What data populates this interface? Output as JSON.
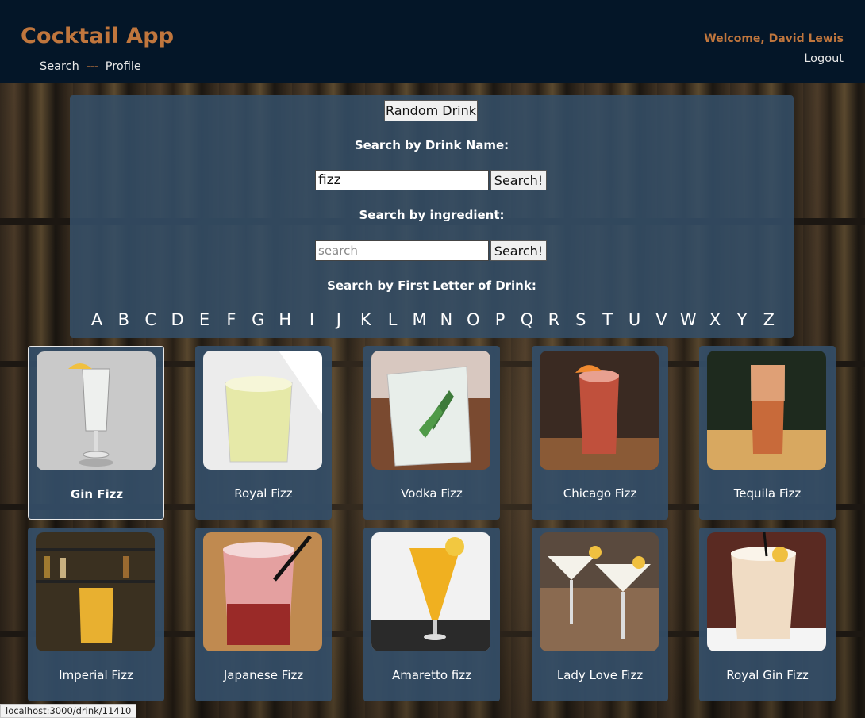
{
  "header": {
    "title": "Cocktail App",
    "nav_search": "Search",
    "nav_sep": "---",
    "nav_profile": "Profile",
    "welcome": "Welcome, David Lewis",
    "logout": "Logout"
  },
  "search": {
    "random_label": "Random Drink",
    "by_name_label": "Search by Drink Name:",
    "name_value": "fizz",
    "by_ingredient_label": "Search by ingredient:",
    "ingredient_placeholder": "search",
    "button_label": "Search!",
    "by_letter_label": "Search by First Letter of Drink:",
    "letters": [
      "A",
      "B",
      "C",
      "D",
      "E",
      "F",
      "G",
      "H",
      "I",
      "J",
      "K",
      "L",
      "M",
      "N",
      "O",
      "P",
      "Q",
      "R",
      "S",
      "T",
      "U",
      "V",
      "W",
      "X",
      "Y",
      "Z"
    ]
  },
  "drinks": [
    {
      "name": "Gin Fizz",
      "icon": "gin-fizz-photo"
    },
    {
      "name": "Royal Fizz",
      "icon": "royal-fizz-photo"
    },
    {
      "name": "Vodka Fizz",
      "icon": "vodka-fizz-photo"
    },
    {
      "name": "Chicago Fizz",
      "icon": "chicago-fizz-photo"
    },
    {
      "name": "Tequila Fizz",
      "icon": "tequila-fizz-photo"
    },
    {
      "name": "Imperial Fizz",
      "icon": "imperial-fizz-photo"
    },
    {
      "name": "Japanese Fizz",
      "icon": "japanese-fizz-photo"
    },
    {
      "name": "Amaretto fizz",
      "icon": "amaretto-fizz-photo"
    },
    {
      "name": "Lady Love Fizz",
      "icon": "lady-love-fizz-photo"
    },
    {
      "name": "Royal Gin Fizz",
      "icon": "royal-gin-fizz-photo"
    }
  ],
  "status": {
    "url": "localhost:3000/drink/11410"
  },
  "colors": {
    "header_bg": "#041628",
    "accent": "#c0763d",
    "panel": "#344e68"
  }
}
